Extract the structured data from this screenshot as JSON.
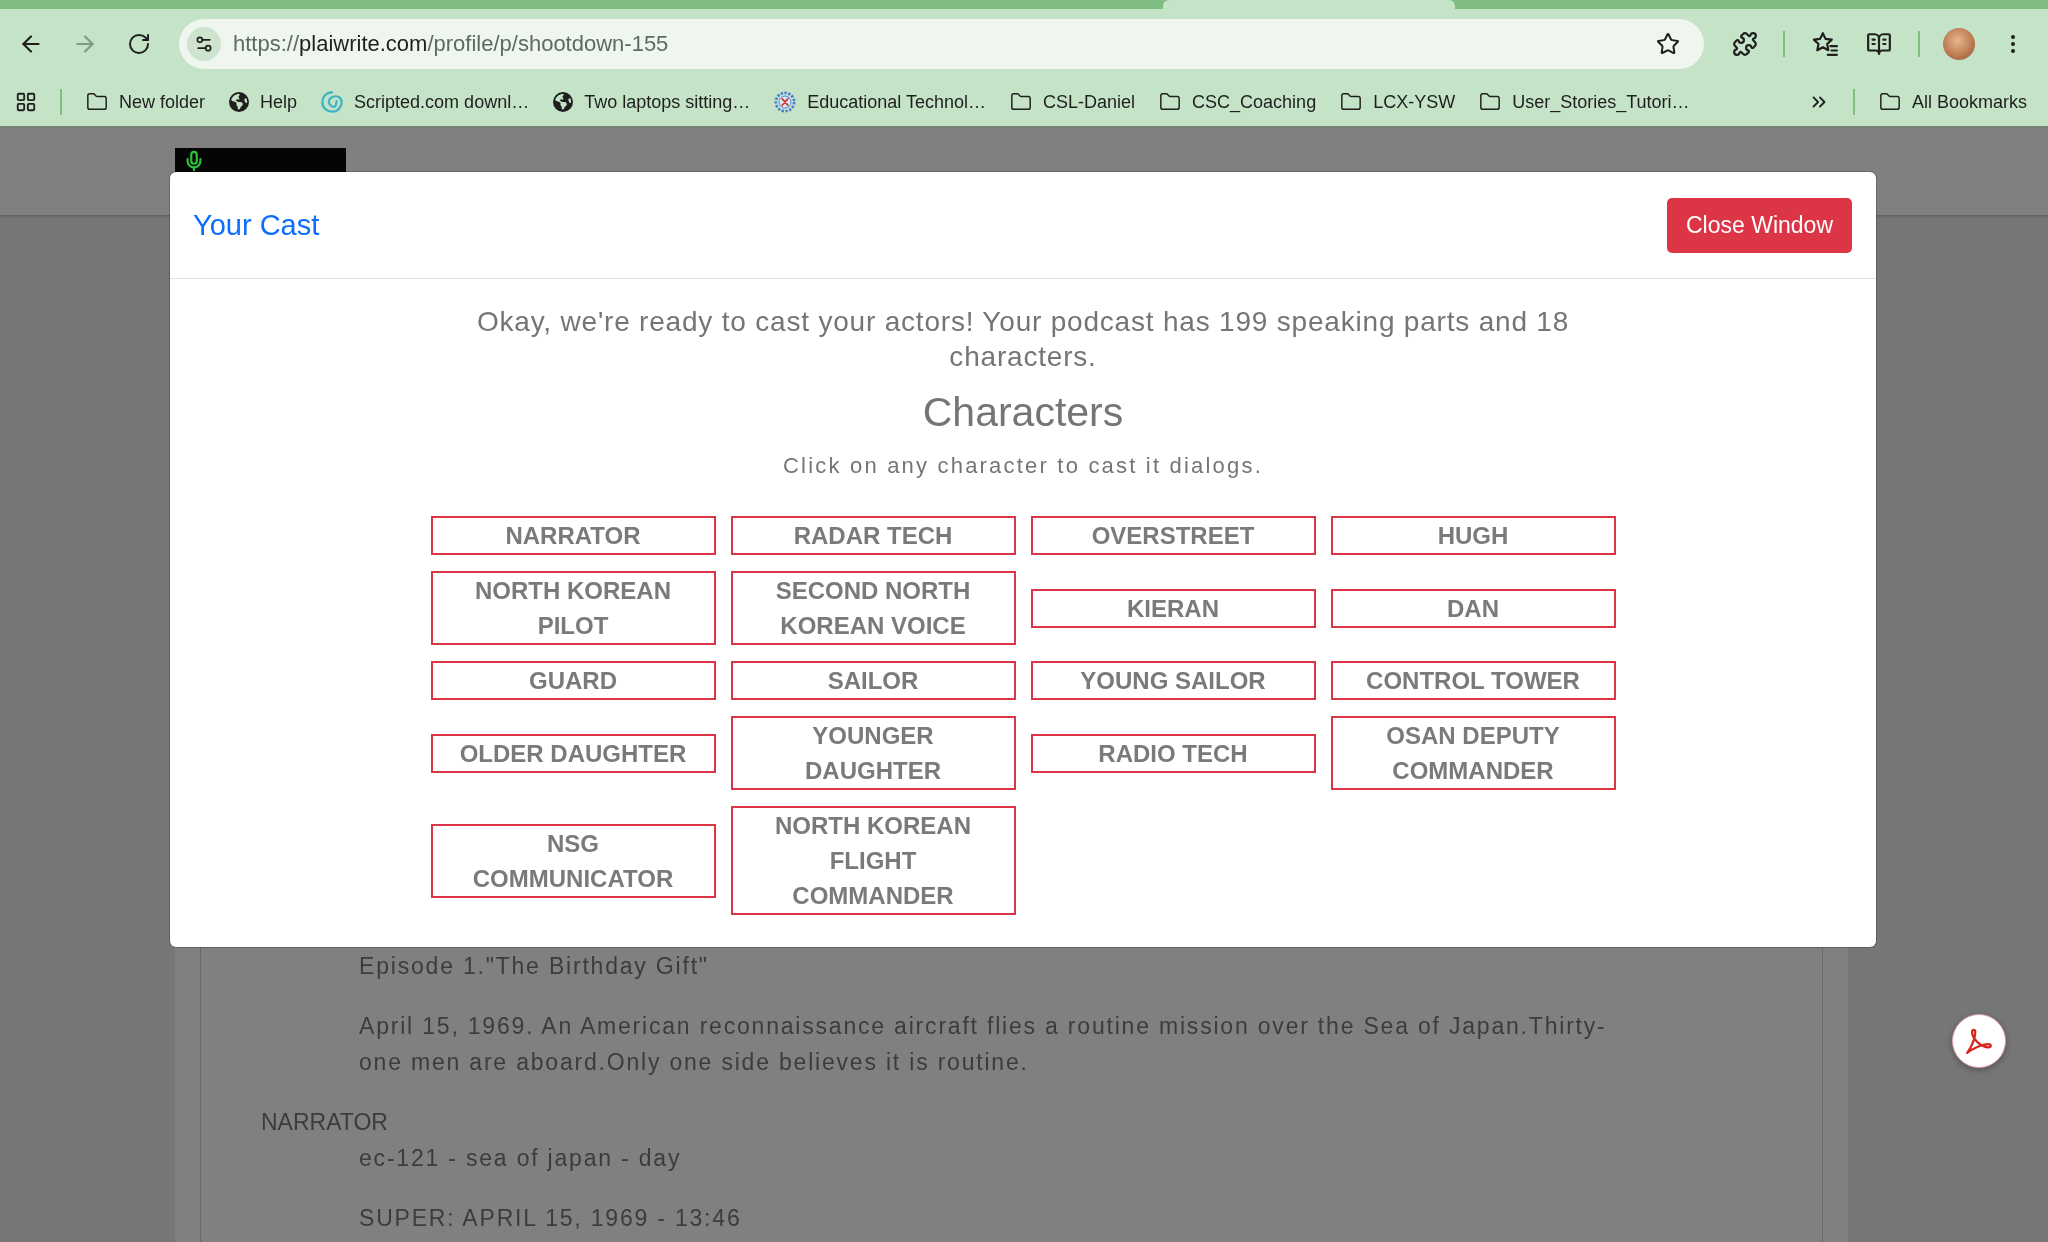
{
  "browser": {
    "forward_disabled": true,
    "url": {
      "scheme": "https://",
      "host": "plaiwrite.com",
      "path": "/profile/p/shootdown-155"
    },
    "bookmarks": [
      {
        "kind": "folder",
        "label": "New folder"
      },
      {
        "kind": "globe",
        "label": "Help"
      },
      {
        "kind": "swirl",
        "label": "Scripted.com downl…"
      },
      {
        "kind": "globe",
        "label": "Two laptops sitting…"
      },
      {
        "kind": "gear",
        "label": "Educational Technol…"
      },
      {
        "kind": "folder",
        "label": "CSL-Daniel"
      },
      {
        "kind": "folder",
        "label": "CSC_Coaching"
      },
      {
        "kind": "folder",
        "label": "LCX-YSW"
      },
      {
        "kind": "folder",
        "label": "User_Stories_Tutori…"
      }
    ],
    "all_bookmarks": "All Bookmarks"
  },
  "script": {
    "episode": "Episode 1.\"The Birthday Gift\"",
    "synopsis": "April 15, 1969. An American reconnaissance aircraft flies a routine mission over the Sea of Japan.Thirty-one men are aboard.Only one side believes it is routine.",
    "speaker": "NARRATOR",
    "lines": [
      "ec-121 - sea of japan - day",
      "SUPER: APRIL 15, 1969 - 13:46"
    ]
  },
  "modal": {
    "title": "Your Cast",
    "close_button": "Close Window",
    "intro": "Okay, we're ready to cast your actors! Your podcast has 199 speaking parts and 18 characters.",
    "heading": "Characters",
    "hint": "Click on any character to cast it dialogs.",
    "characters": [
      "NARRATOR",
      "RADAR TECH",
      "OVERSTREET",
      "HUGH",
      "NORTH KOREAN PILOT",
      "SECOND NORTH KOREAN VOICE",
      "KIERAN",
      "DAN",
      "GUARD",
      "SAILOR",
      "YOUNG SAILOR",
      "CONTROL TOWER",
      "OLDER DAUGHTER",
      "YOUNGER DAUGHTER",
      "RADIO TECH",
      "OSAN DEPUTY COMMANDER",
      "NSG COMMUNICATOR",
      "NORTH KOREAN FLIGHT COMMANDER"
    ]
  }
}
